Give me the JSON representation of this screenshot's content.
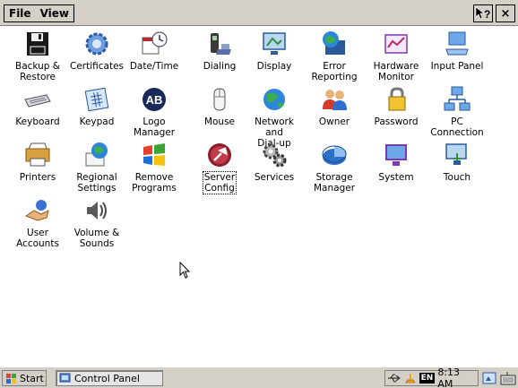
{
  "menu": {
    "file": "File",
    "view": "View"
  },
  "titlebar": {
    "help_icon": "help-question-icon",
    "close": "×"
  },
  "items": [
    {
      "label": "Backup &\nRestore",
      "icon": "floppy-disk-icon"
    },
    {
      "label": "Certificates",
      "icon": "certificate-gear-icon"
    },
    {
      "label": "Date/Time",
      "icon": "calendar-clock-icon"
    },
    {
      "label": "Dialing",
      "icon": "phone-icon"
    },
    {
      "label": "Display",
      "icon": "monitor-icon"
    },
    {
      "label": "Error\nReporting",
      "icon": "globe-monitor-icon"
    },
    {
      "label": "Hardware\nMonitor",
      "icon": "chart-card-icon"
    },
    {
      "label": "Input Panel",
      "icon": "keyboard-monitor-icon"
    },
    {
      "label": "Keyboard",
      "icon": "keyboard-icon"
    },
    {
      "label": "Keypad",
      "icon": "keypad-icon"
    },
    {
      "label": "Logo\nManager",
      "icon": "ab-logo-icon"
    },
    {
      "label": "Mouse",
      "icon": "mouse-icon"
    },
    {
      "label": "Network and\nDial-up Co...",
      "icon": "network-globe-icon"
    },
    {
      "label": "Owner",
      "icon": "people-icon"
    },
    {
      "label": "Password",
      "icon": "key-lock-icon"
    },
    {
      "label": "PC\nConnection",
      "icon": "pc-connection-icon"
    },
    {
      "label": "Printers",
      "icon": "printer-icon"
    },
    {
      "label": "Regional\nSettings",
      "icon": "globe-book-icon"
    },
    {
      "label": "Remove\nPrograms",
      "icon": "windows-flag-icon"
    },
    {
      "label": "Server\nConfig",
      "icon": "server-config-icon"
    },
    {
      "label": "Services",
      "icon": "gears-icon"
    },
    {
      "label": "Storage\nManager",
      "icon": "pie-disk-icon"
    },
    {
      "label": "System",
      "icon": "system-monitor-icon"
    },
    {
      "label": "Touch",
      "icon": "touch-monitor-icon"
    },
    {
      "label": "User\nAccounts",
      "icon": "handshake-icon"
    },
    {
      "label": "Volume &\nSounds",
      "icon": "speaker-icon"
    }
  ],
  "taskbar": {
    "start": "Start",
    "task": "Control Panel",
    "lang": "EN",
    "time": "8:13 AM"
  }
}
